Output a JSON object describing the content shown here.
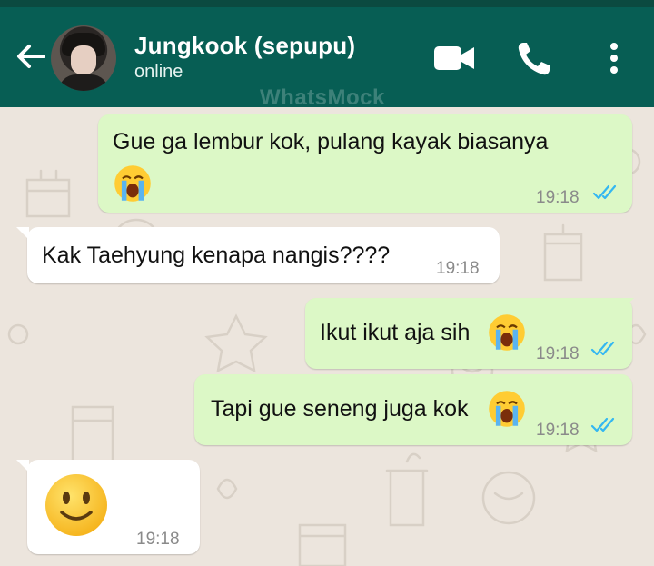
{
  "header": {
    "contact_name": "Jungkook (sepupu)",
    "status": "online",
    "watermark": "WhatsMock",
    "colors": {
      "bar": "#075e54",
      "statusbar": "#0b4a40"
    },
    "icons": [
      "back-arrow-icon",
      "avatar",
      "video-call-icon",
      "phone-call-icon",
      "more-options-icon"
    ]
  },
  "messages": [
    {
      "direction": "outgoing",
      "text": "Gue ga lembur kok, pulang kayak biasanya",
      "emoji": "loudly-crying-face",
      "time": "19:18",
      "read": true
    },
    {
      "direction": "incoming",
      "text": "Kak Taehyung kenapa nangis????",
      "time": "19:18"
    },
    {
      "direction": "outgoing",
      "text": "Ikut ikut aja sih",
      "emoji": "loudly-crying-face",
      "time": "19:18",
      "read": true
    },
    {
      "direction": "outgoing",
      "text": "Tapi gue seneng juga kok",
      "emoji": "loudly-crying-face",
      "time": "19:18",
      "read": true
    },
    {
      "direction": "incoming",
      "text": "",
      "emoji": "slightly-smiling-face",
      "time": "19:18"
    }
  ],
  "colors": {
    "outgoing_bubble": "#dcf8c6",
    "incoming_bubble": "#ffffff",
    "chat_bg": "#ece5dd",
    "read_ticks": "#34b7f1"
  }
}
